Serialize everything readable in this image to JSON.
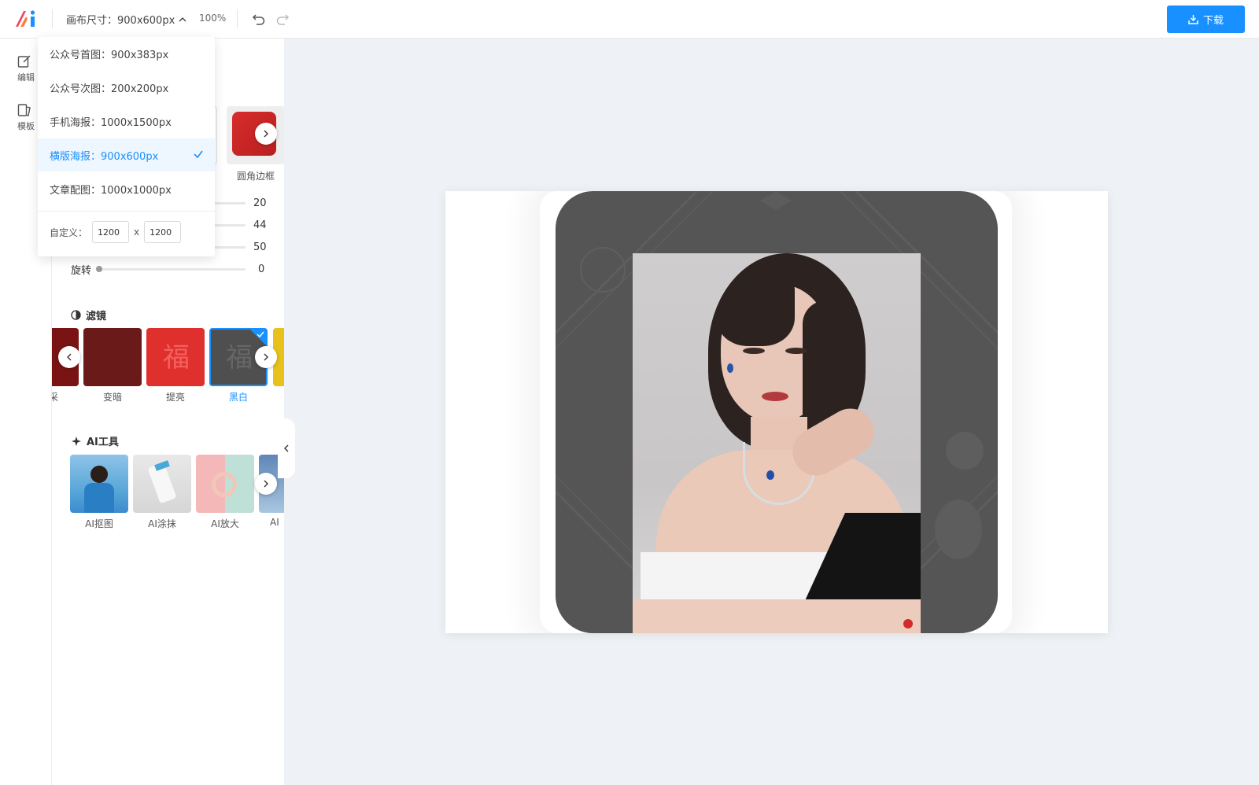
{
  "header": {
    "canvas_size_label": "画布尺寸：900x600px",
    "zoom": "100%",
    "download_label": "下载",
    "accent_color": "#1890ff"
  },
  "rail": {
    "items": [
      {
        "label": "编辑",
        "icon": "edit-icon"
      },
      {
        "label": "模板",
        "icon": "template-icon"
      }
    ]
  },
  "dropdown": {
    "options": [
      {
        "label": "公众号首图：900x383px"
      },
      {
        "label": "公众号次图：200x200px"
      },
      {
        "label": "手机海报：1000x1500px"
      },
      {
        "label": "横版海报：900x600px",
        "selected": true
      },
      {
        "label": "文章配图：1000x1000px"
      }
    ],
    "custom_label": "自定义：",
    "custom_width": "1200",
    "custom_height": "1200",
    "custom_x": "x"
  },
  "frames": {
    "visible_label": "圆角边框"
  },
  "sliders": [
    {
      "value": "20"
    },
    {
      "value": "44"
    },
    {
      "value": "50"
    },
    {
      "label": "旋转",
      "value": "0"
    }
  ],
  "filters": {
    "title": "滤镜",
    "items": [
      {
        "label": "采",
        "color": "#7a1414"
      },
      {
        "label": "变暗",
        "color": "#6b1a1a"
      },
      {
        "label": "提亮",
        "color": "#e0302e"
      },
      {
        "label": "黑白",
        "color": "#4f4f4f",
        "selected": true
      },
      {
        "label": "",
        "color": "#e8c21a"
      }
    ]
  },
  "ai_tools": {
    "title": "AI工具",
    "items": [
      {
        "label": "AI抠图"
      },
      {
        "label": "AI涂抹"
      },
      {
        "label": "AI放大"
      },
      {
        "label": "AI"
      }
    ]
  }
}
